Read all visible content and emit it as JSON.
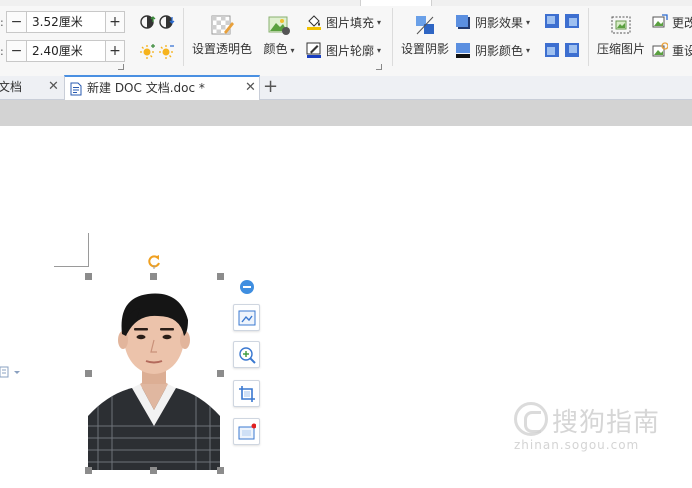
{
  "size": {
    "height_value": "3.52厘米",
    "width_value": "2.40厘米",
    "minus_label": "−",
    "plus_label": "+",
    "label_colon": ":"
  },
  "ribbon": {
    "set_transparent_label": "设置透明色",
    "color_label": "颜色",
    "picture_fill_label": "图片填充",
    "picture_outline_label": "图片轮廓",
    "set_shadow_label": "设置阴影",
    "shadow_effect_label": "阴影效果",
    "shadow_color_label": "阴影颜色",
    "compress_label": "压缩图片",
    "change_label": "更改",
    "reset_label": "重设",
    "dropdown_caret": "▾"
  },
  "tabs": {
    "prev_tab_label": "文档",
    "active_tab_label": "新建 DOC 文档.doc *",
    "close_glyph": "✕",
    "new_tab_glyph": "+"
  },
  "watermark": {
    "main_text": "搜狗指南",
    "sub_text": "zhinan.sogou.com"
  },
  "colors": {
    "accent": "#4a90e2",
    "ribbon_bg": "#f7f7f7",
    "tabbar_bg": "#eef0f4",
    "strip_gray": "#d3d3d3",
    "handle_gray": "#8c8c8c",
    "rotate_orange": "#f0a020"
  }
}
